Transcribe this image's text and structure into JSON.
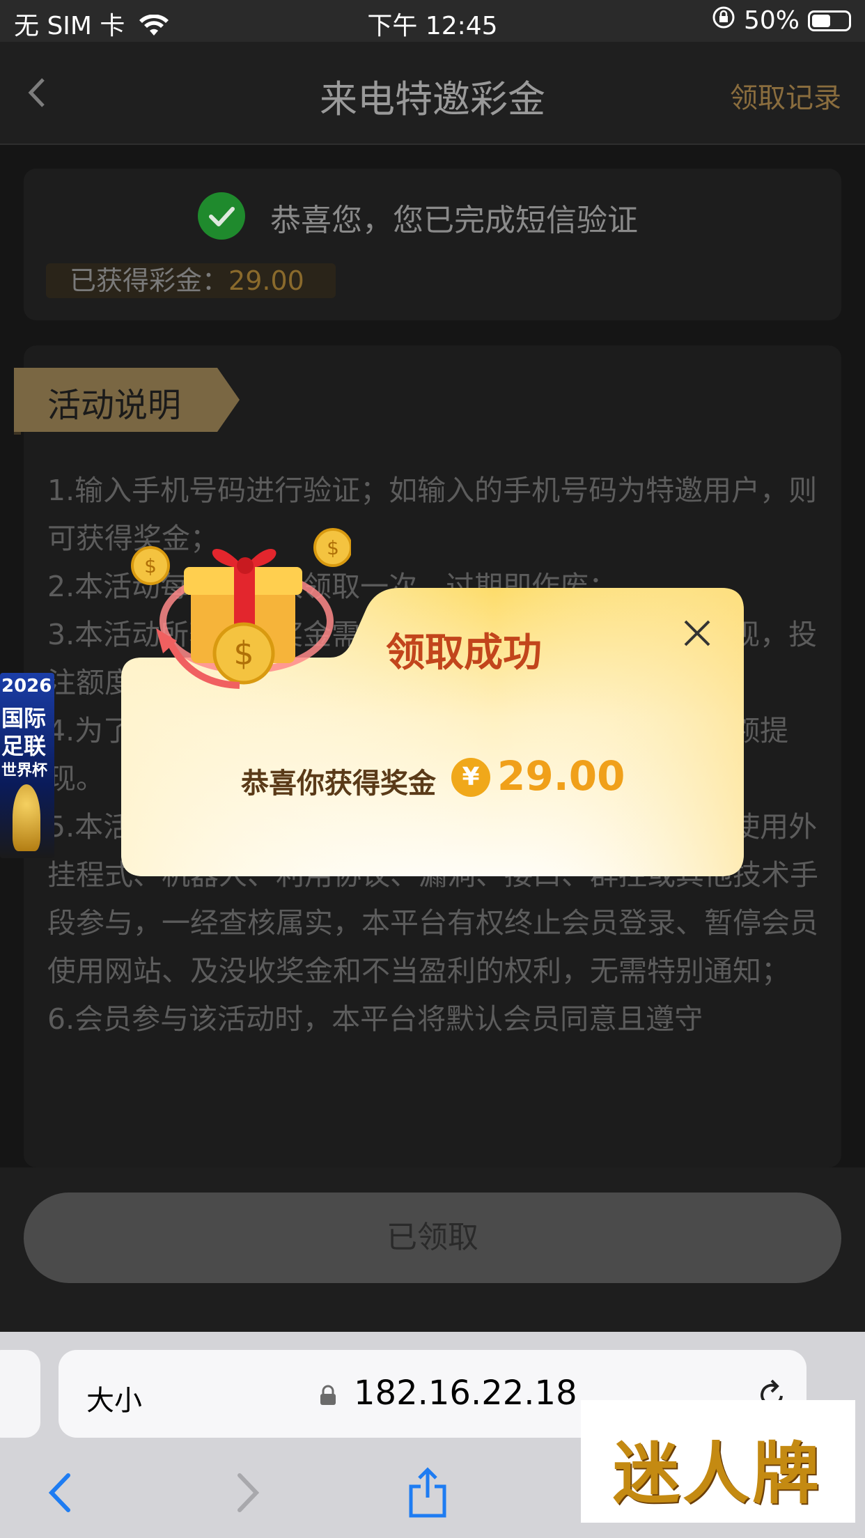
{
  "status_bar": {
    "carrier": "无 SIM 卡",
    "time": "下午 12:45",
    "battery": "50%",
    "battery_level": 0.5
  },
  "header": {
    "title": "来电特邀彩金",
    "records_link": "领取记录"
  },
  "verification": {
    "message": "恭喜您，您已完成短信验证",
    "earned_label": "已获得彩金：",
    "earned_value": "29.00"
  },
  "activity": {
    "tag_label": "活动说明",
    "rules": [
      "1.输入手机号码进行验证；如输入的手机号码为特邀用户，则可获得奖金；",
      "2.本活动每个账号限领取一次，过期即作废；",
      "3.本活动所获得的奖金需完成一定有效投注且…方可提现，投注额度≥…0元，…",
      "4.为了…，需先完成短信验证…方可领取，领取后…余额提现。",
      "5.本活动仅限账号本人领取奖励，禁止租借账号，不得使用外挂程式、机器人、利用协议、漏洞、接口、群控或其他技术手段参与，一经查核属实，本平台有权终止会员登录、暂停会员使用网站、及没收奖金和不当盈利的权利，无需特别通知；",
      "6.会员参与该活动时，本平台将默认会员同意且遵守"
    ]
  },
  "claim_button": {
    "label": "已领取"
  },
  "promo_banner": {
    "year": "2026",
    "line1": "国际",
    "line2": "足联",
    "line3": "世界杯"
  },
  "modal": {
    "title": "领取成功",
    "message": "恭喜你获得奖金",
    "currency_symbol": "¥",
    "amount": "29.00"
  },
  "browser": {
    "text_size": "大小",
    "url": "182.16.22.18"
  },
  "watermark": {
    "text": "迷人牌"
  },
  "colors": {
    "accent_gold": "#8a6d3e",
    "success_green": "#1f8a2d",
    "modal_title": "#c2451c",
    "amount_orange": "#f0a01a"
  }
}
